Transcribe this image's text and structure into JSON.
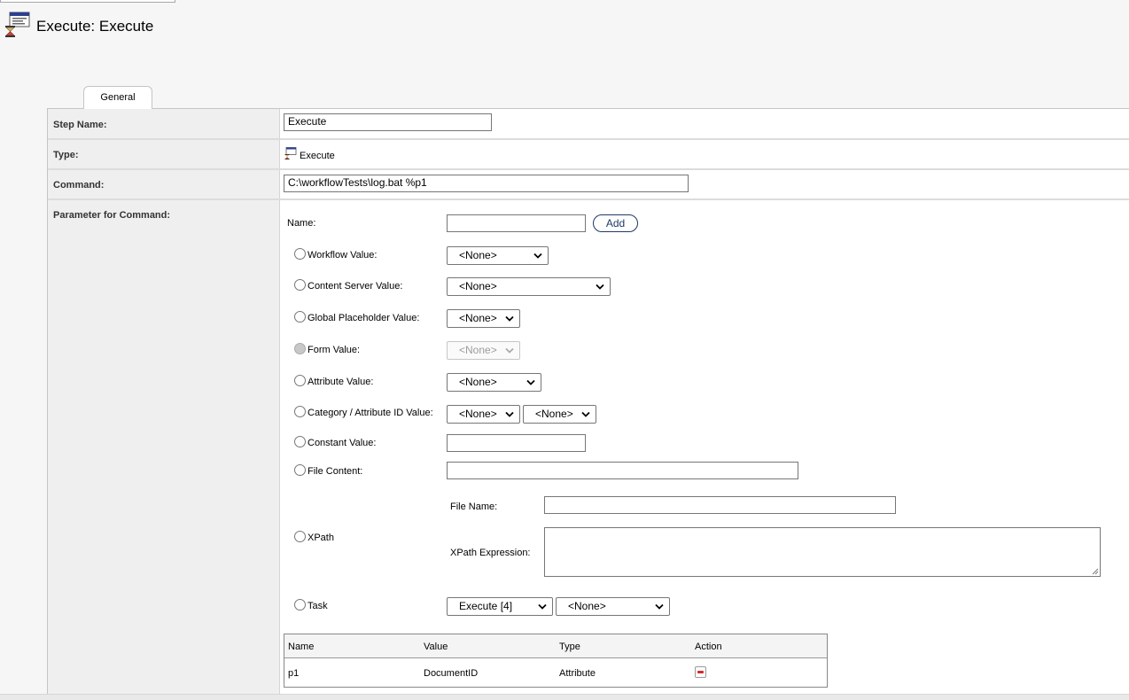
{
  "page": {
    "title": "Execute: Execute"
  },
  "tabs": [
    {
      "label": "General"
    }
  ],
  "form": {
    "step_name": {
      "label": "Step Name:",
      "value": "Execute"
    },
    "type": {
      "label": "Type:",
      "value": "Execute"
    },
    "command": {
      "label": "Command:",
      "value": "C:\\workflowTests\\log.bat %p1"
    },
    "parameter": {
      "label": "Parameter for Command:",
      "name_label": "Name:",
      "name_value": "",
      "add_label": "Add",
      "workflow_value": {
        "label": "Workflow Value:",
        "selected": "<None>"
      },
      "content_server_value": {
        "label": "Content Server Value:",
        "selected": "<None>"
      },
      "global_placeholder_value": {
        "label": "Global Placeholder Value:",
        "selected": "<None>"
      },
      "form_value": {
        "label": "Form Value:",
        "selected": "<None>"
      },
      "attribute_value": {
        "label": "Attribute Value:",
        "selected": "<None>"
      },
      "category_attribute_id_value": {
        "label": "Category / Attribute ID Value:",
        "selected1": "<None>",
        "selected2": "<None>"
      },
      "constant_value": {
        "label": "Constant Value:",
        "value": ""
      },
      "file_content": {
        "label": "File Content:",
        "value": ""
      },
      "xpath": {
        "label": "XPath",
        "file_name_label": "File Name:",
        "file_name_value": "",
        "expression_label": "XPath Expression:"
      },
      "task": {
        "label": "Task",
        "selected1": "Execute [4]",
        "selected2": "<None>"
      }
    }
  },
  "params_table": {
    "headers": {
      "name": "Name",
      "value": "Value",
      "type": "Type",
      "action": "Action"
    },
    "rows": [
      {
        "name": "p1",
        "value": "DocumentID",
        "type": "Attribute",
        "action_icon": "delete-icon"
      }
    ]
  }
}
